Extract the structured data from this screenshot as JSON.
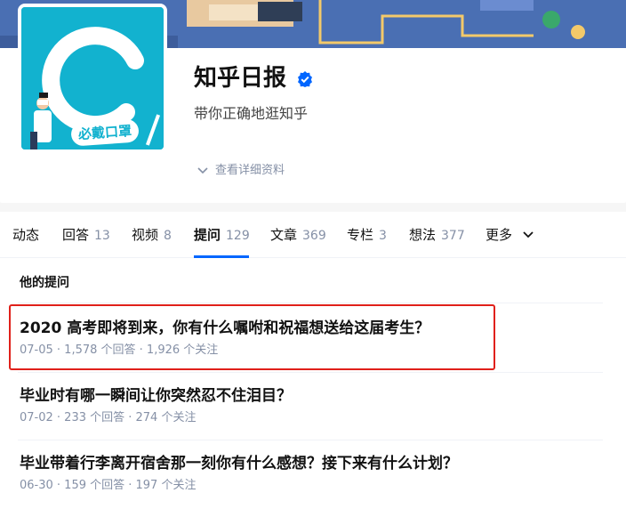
{
  "profile": {
    "name": "知乎日报",
    "headline": "带你正确地逛知乎",
    "avatar_badge": "必戴口罩",
    "detail_link": "查看详细资料",
    "verified_icon": "verified-badge-icon",
    "colors": {
      "banner": "#4a6fb3",
      "avatar_bg": "#12b2cf",
      "verified": "#0066ff"
    }
  },
  "tabs": [
    {
      "label": "动态",
      "count": ""
    },
    {
      "label": "回答",
      "count": "13"
    },
    {
      "label": "视频",
      "count": "8"
    },
    {
      "label": "提问",
      "count": "129"
    },
    {
      "label": "文章",
      "count": "369"
    },
    {
      "label": "专栏",
      "count": "3"
    },
    {
      "label": "想法",
      "count": "377"
    },
    {
      "label": "更多",
      "count": ""
    }
  ],
  "active_tab": "提问",
  "section_title": "他的提问",
  "questions": [
    {
      "title": "2020 高考即将到来，你有什么嘱咐和祝福想送给这届考生？",
      "meta": "07-05 · 1,578 个回答 · 1,926 个关注"
    },
    {
      "title": "毕业时有哪一瞬间让你突然忍不住泪目？",
      "meta": "07-02 · 233 个回答 · 274 个关注"
    },
    {
      "title": "毕业带着行李离开宿舍那一刻你有什么感想？接下来有什么计划？",
      "meta": "06-30 · 159 个回答 · 197 个关注"
    }
  ],
  "accent_colors": {
    "primary": "#0066ff",
    "highlight_box": "#e0201a",
    "meta_text": "#8590a6"
  }
}
